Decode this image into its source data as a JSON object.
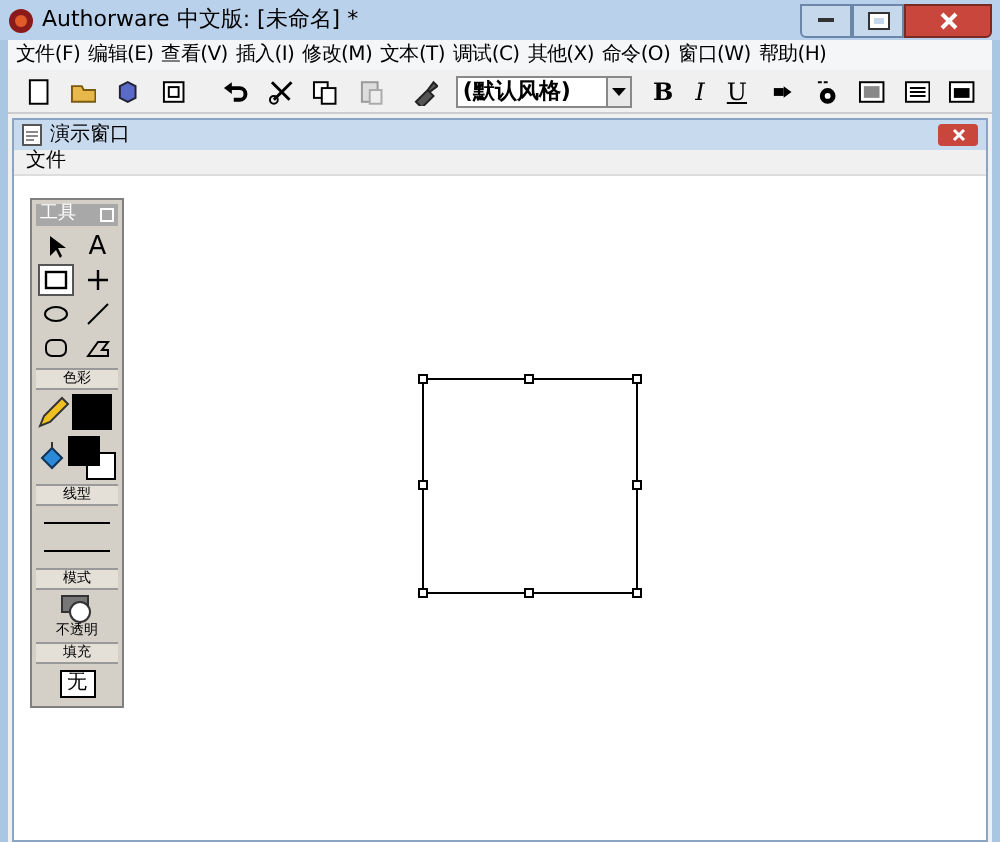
{
  "window": {
    "title": "Authorware 中文版: [未命名] *"
  },
  "menu": [
    "文件(F)",
    "编辑(E)",
    "查看(V)",
    "插入(I)",
    "修改(M)",
    "文本(T)",
    "调试(C)",
    "其他(X)",
    "命令(O)",
    "窗口(W)",
    "帮助(H)"
  ],
  "toolbar": {
    "style_dropdown": {
      "value": "(默认风格)"
    },
    "format_buttons": [
      "B",
      "I",
      "U"
    ]
  },
  "presentation_window": {
    "title": "演示窗口",
    "menu": [
      "文件"
    ]
  },
  "tool_palette": {
    "title": "工具",
    "tools": [
      {
        "kind": "pointer",
        "selected": false
      },
      {
        "kind": "text",
        "label": "A",
        "selected": false
      },
      {
        "kind": "rect",
        "selected": true
      },
      {
        "kind": "cross",
        "selected": false
      },
      {
        "kind": "ellipse",
        "selected": false
      },
      {
        "kind": "line",
        "selected": false
      },
      {
        "kind": "roundrect",
        "selected": false
      },
      {
        "kind": "polygon",
        "selected": false
      }
    ],
    "color_section": "色彩",
    "line_section": "线型",
    "mode_section": "模式",
    "mode_value": "不透明",
    "fill_section": "填充",
    "fill_value": "无"
  }
}
